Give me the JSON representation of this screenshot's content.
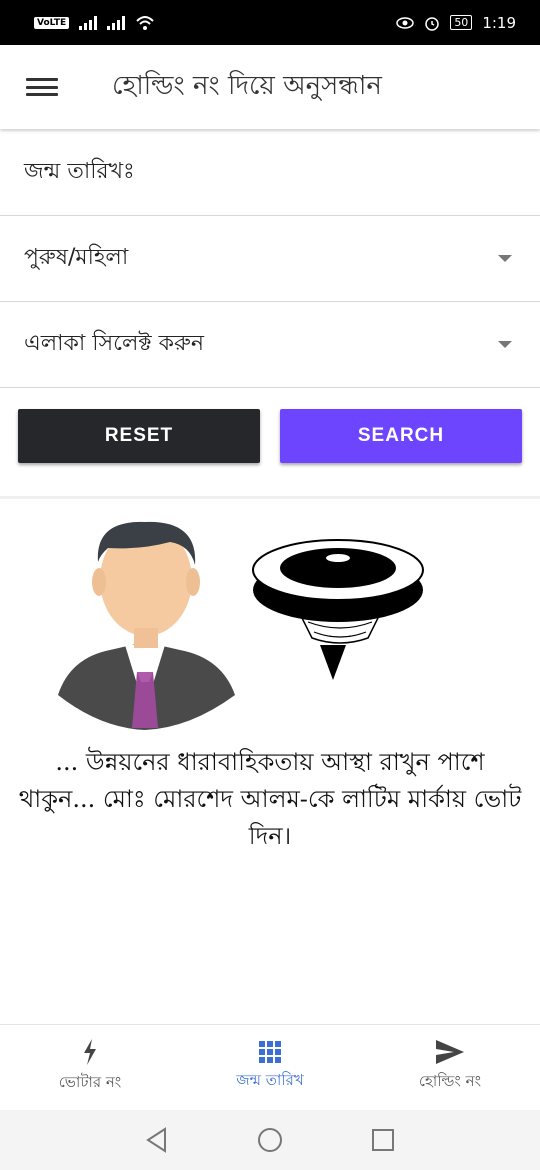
{
  "status_bar": {
    "volte": "VoLTE",
    "battery": "50",
    "time": "1:19"
  },
  "app_bar": {
    "title": "হোল্ডিং নং দিয়ে অনুসন্ধান",
    "menu_icon": "menu-icon"
  },
  "form": {
    "dob_label": "জন্ম তারিখঃ",
    "gender_selected": "পুরুষ/মহিলা",
    "area_selected": "এলাকা সিলেক্ট করুন"
  },
  "buttons": {
    "reset": "RESET",
    "search": "SEARCH"
  },
  "colors": {
    "reset_bg": "#25272b",
    "search_bg": "#6d45ff",
    "active_nav": "#3b6fd4"
  },
  "message": "... উন্নয়নের ধারাবাহিকতায় আস্থা রাখুন পাশে থাকুন... মোঃ মোরশেদ আলম-কে লাটিম মার্কায় ভোট দিন।",
  "bottom_nav": [
    {
      "label": "ভোটার নং",
      "icon": "flash-icon",
      "active": false
    },
    {
      "label": "জন্ম তারিখ",
      "icon": "grid-icon",
      "active": true
    },
    {
      "label": "হোল্ডিং নং",
      "icon": "send-icon",
      "active": false
    }
  ]
}
